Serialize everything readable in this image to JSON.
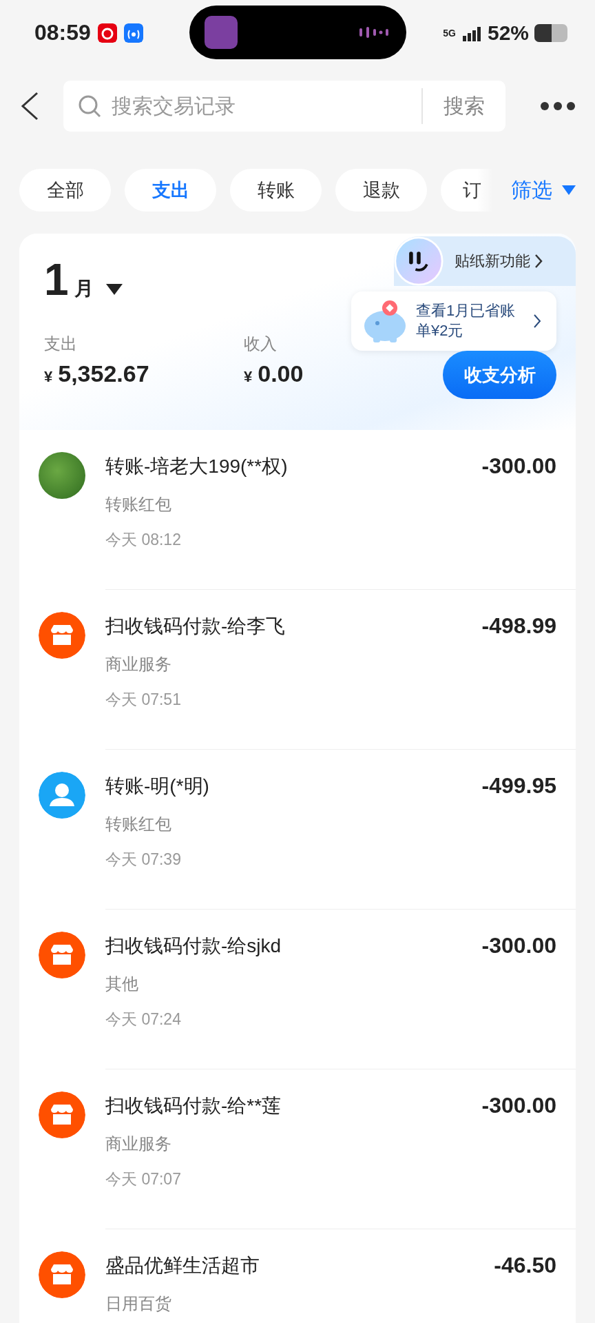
{
  "status_bar": {
    "time": "08:59",
    "network": "5G",
    "battery": "52%"
  },
  "search": {
    "placeholder": "搜索交易记录",
    "button": "搜索"
  },
  "tabs": [
    {
      "label": "全部",
      "selected": false
    },
    {
      "label": "支出",
      "selected": true
    },
    {
      "label": "转账",
      "selected": false
    },
    {
      "label": "退款",
      "selected": false
    },
    {
      "label": "订",
      "selected": false
    }
  ],
  "filter": "筛选",
  "summary": {
    "month": "1",
    "month_unit": "月",
    "sticker_promo": "贴纸新功能",
    "tip": "查看1月已省账单¥2元",
    "expense_label": "支出",
    "expense_currency": "¥",
    "expense": "5,352.67",
    "income_label": "收入",
    "income_currency": "¥",
    "income": "0.00",
    "analysis_button": "收支分析"
  },
  "transactions": [
    {
      "kind": "photo",
      "title": "转账-培老大199(**权)",
      "category": "转账红包",
      "time": "今天 08:12",
      "amount": "-300.00"
    },
    {
      "kind": "shop",
      "title": "扫收钱码付款-给李飞",
      "category": "商业服务",
      "time": "今天 07:51",
      "amount": "-498.99"
    },
    {
      "kind": "person",
      "title": "转账-明(*明)",
      "category": "转账红包",
      "time": "今天 07:39",
      "amount": "-499.95"
    },
    {
      "kind": "shop",
      "title": "扫收钱码付款-给sjkd",
      "category": "其他",
      "time": "今天 07:24",
      "amount": "-300.00"
    },
    {
      "kind": "shop",
      "title": "扫收钱码付款-给**莲",
      "category": "商业服务",
      "time": "今天 07:07",
      "amount": "-300.00"
    },
    {
      "kind": "shop",
      "title": "盛品优鲜生活超市",
      "category": "日用百货",
      "amount": "-46.50"
    }
  ]
}
